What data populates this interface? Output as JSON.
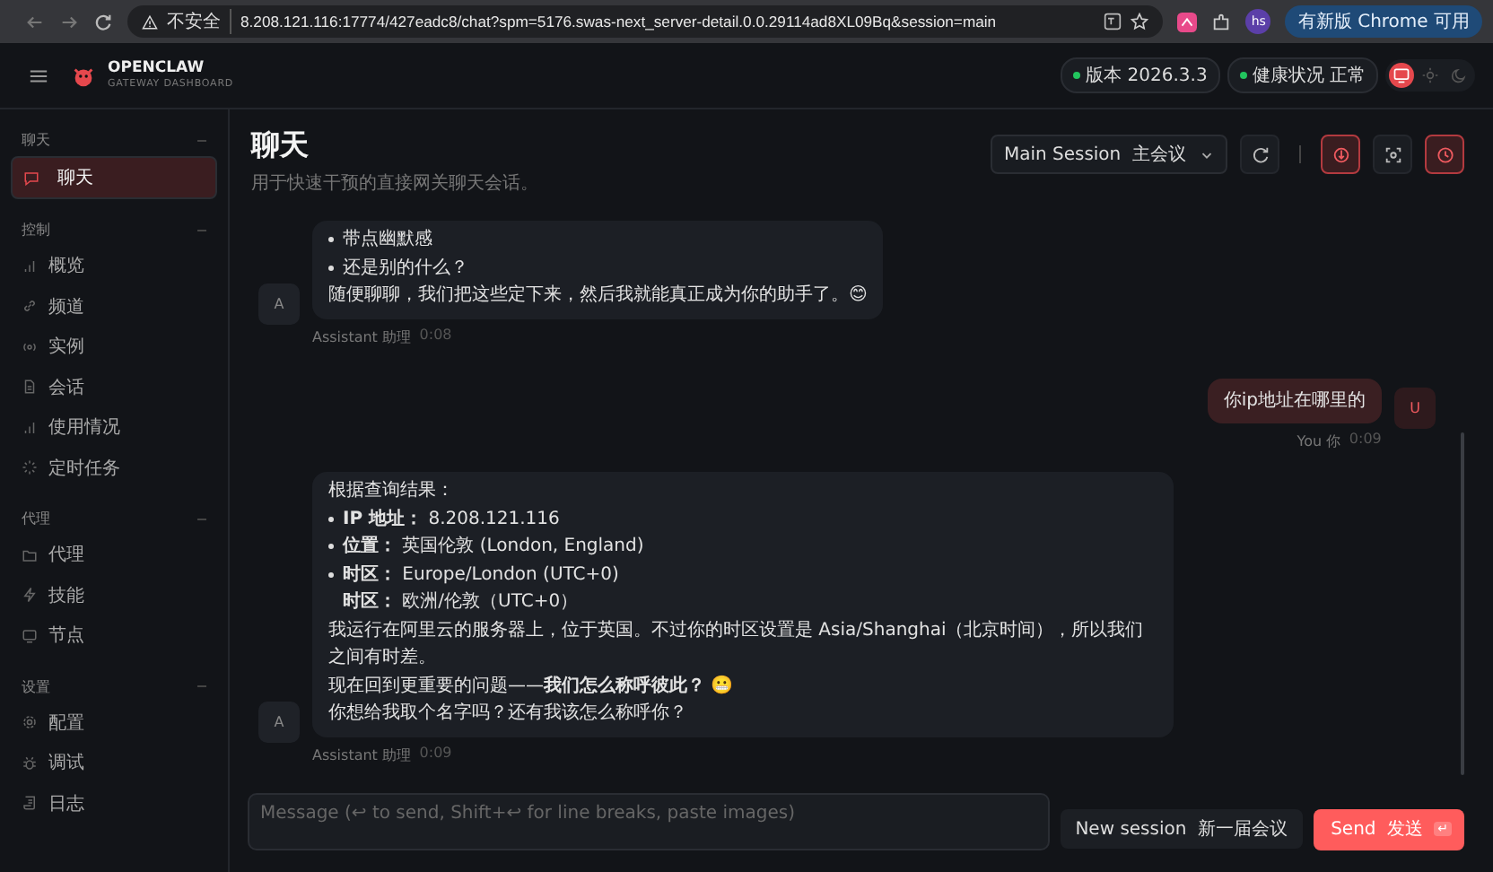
{
  "browser": {
    "security_label": "不安全",
    "url": "8.208.121.116:17774/427eadc8/chat?spm=5176.swas-next_server-detail.0.0.29114ad8XL09Bq&session=main",
    "profile": "hs",
    "update_button": "有新版 Chrome 可用"
  },
  "header": {
    "brand": "OPENCLAW",
    "tagline": "GATEWAY DASHBOARD",
    "status_pills": [
      {
        "label": "版本 2026.3.3",
        "color": "#22c55e"
      },
      {
        "label": "健康状况 正常",
        "color": "#22c55e"
      }
    ],
    "theme_options": [
      {
        "kind": "system",
        "selected": true
      },
      {
        "kind": "light",
        "selected": false
      },
      {
        "kind": "dark",
        "selected": false
      }
    ]
  },
  "sidebar": {
    "groups": [
      {
        "title": "聊天",
        "items": [
          {
            "label": "聊天",
            "kind": "chat",
            "selected": true
          }
        ]
      },
      {
        "title": "控制",
        "items": [
          {
            "label": "概览",
            "kind": "bars",
            "selected": false
          },
          {
            "label": "频道",
            "kind": "link",
            "selected": false
          },
          {
            "label": "实例",
            "kind": "radio",
            "selected": false
          },
          {
            "label": "会话",
            "kind": "file",
            "selected": false
          },
          {
            "label": "使用情况",
            "kind": "bars",
            "selected": false
          },
          {
            "label": "定时任务",
            "kind": "loader",
            "selected": false
          }
        ]
      },
      {
        "title": "代理",
        "items": [
          {
            "label": "代理",
            "kind": "folder",
            "selected": false
          },
          {
            "label": "技能",
            "kind": "zap",
            "selected": false
          },
          {
            "label": "节点",
            "kind": "monitor",
            "selected": false
          }
        ]
      },
      {
        "title": "设置",
        "items": [
          {
            "label": "配置",
            "kind": "gear",
            "selected": false
          },
          {
            "label": "调试",
            "kind": "bug",
            "selected": false
          },
          {
            "label": "日志",
            "kind": "scroll",
            "selected": false
          }
        ]
      }
    ]
  },
  "page": {
    "title": "聊天",
    "subtitle": "用于快速干预的直接网关聊天会话。"
  },
  "toolbar": {
    "session_select": "Main Session  主会议",
    "toggles": [
      {
        "kind": "brain",
        "on": true
      },
      {
        "kind": "focus",
        "on": false
      },
      {
        "kind": "clock",
        "on": true
      }
    ]
  },
  "messages": [
    {
      "kind": "assistant",
      "avatar": "A",
      "sender": "Assistant 助理",
      "time": "0:08",
      "blocks": [
        {
          "kind": "bullet",
          "text": "带点幽默感"
        },
        {
          "kind": "bullet",
          "text": "还是别的什么？"
        },
        {
          "kind": "para",
          "text": "随便聊聊，我们把这些定下来，然后我就能真正成为你的助手了。😊"
        }
      ]
    },
    {
      "kind": "user",
      "avatar": "U",
      "sender": "You 你",
      "time": "0:09",
      "blocks": [
        {
          "kind": "para",
          "text": "你ip地址在哪里的"
        }
      ]
    },
    {
      "kind": "assistant",
      "avatar": "A",
      "sender": "Assistant 助理",
      "time": "0:09",
      "blocks": [
        {
          "kind": "para",
          "text": "根据查询结果："
        },
        {
          "kind": "bullet",
          "text": "**IP 地址：** 8.208.121.116"
        },
        {
          "kind": "bullet",
          "text": "**位置：** 英国伦敦 (London, England)"
        },
        {
          "kind": "bullet",
          "text": "**时区：** Europe/London (UTC+0)"
        },
        {
          "kind": "indent",
          "text": "**时区：** 欧洲/伦敦（UTC+0）"
        },
        {
          "kind": "para",
          "text": "我运行在阿里云的服务器上，位于英国。不过你的时区设置是 Asia/Shanghai（北京时间），所以我们之间有时差。"
        },
        {
          "kind": "para",
          "text": "现在回到更重要的问题——**我们怎么称呼彼此？** 😬"
        },
        {
          "kind": "para",
          "text": "你想给我取个名字吗？还有我该怎么称呼你？"
        }
      ]
    }
  ],
  "composer": {
    "placeholder": "Message (↩ to send, Shift+↩ for line breaks, paste images)",
    "new_session": "New session  新一届会议",
    "send": "Send  发送",
    "send_key": "↵"
  }
}
